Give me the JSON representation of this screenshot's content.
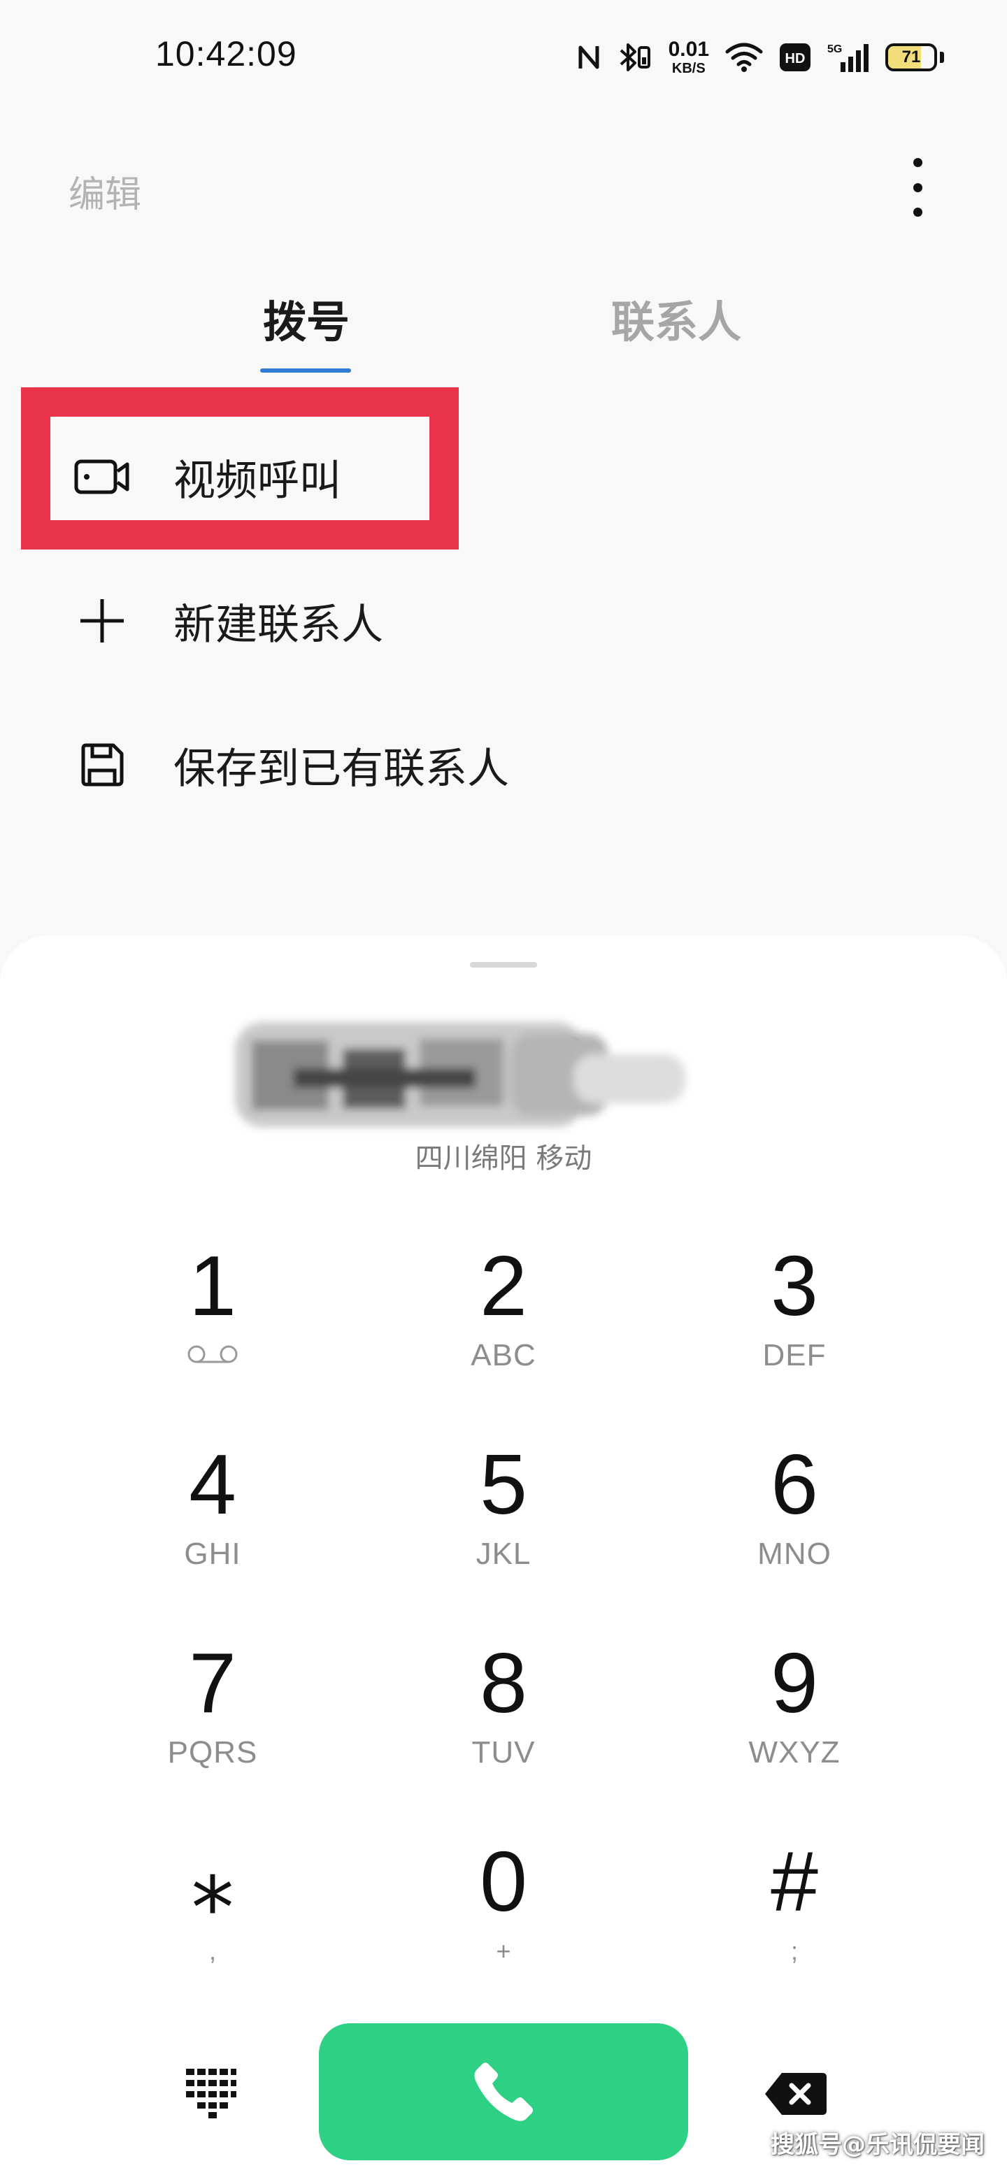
{
  "status_bar": {
    "time": "10:42:09",
    "net_speed_value": "0.01",
    "net_speed_unit": "KB/S",
    "hd_label": "HD",
    "network_label": "5G",
    "battery_percent": 71,
    "battery_label": "71",
    "icons": [
      "nfc-icon",
      "bluetooth-icon",
      "wifi-icon",
      "hd-voice-icon",
      "signal-icon",
      "battery-icon"
    ]
  },
  "header": {
    "edit_label": "编辑",
    "more_icon": "more-vertical-icon"
  },
  "tabs": [
    {
      "label": "拨号",
      "active": true
    },
    {
      "label": "联系人",
      "active": false
    }
  ],
  "options": [
    {
      "label": "视频呼叫",
      "icon": "video-call-icon",
      "highlighted": true
    },
    {
      "label": "新建联系人",
      "icon": "plus-icon"
    },
    {
      "label": "保存到已有联系人",
      "icon": "save-icon"
    }
  ],
  "dialer": {
    "number_visible": "1          33",
    "location": "四川绵阳 移动"
  },
  "keypad": [
    {
      "digit": "1",
      "letters": "",
      "icon": "voicemail-icon"
    },
    {
      "digit": "2",
      "letters": "ABC"
    },
    {
      "digit": "3",
      "letters": "DEF"
    },
    {
      "digit": "4",
      "letters": "GHI"
    },
    {
      "digit": "5",
      "letters": "JKL"
    },
    {
      "digit": "6",
      "letters": "MNO"
    },
    {
      "digit": "7",
      "letters": "PQRS"
    },
    {
      "digit": "8",
      "letters": "TUV"
    },
    {
      "digit": "9",
      "letters": "WXYZ"
    },
    {
      "digit": "⁎",
      "letters": ","
    },
    {
      "digit": "0",
      "letters": "+"
    },
    {
      "digit": "#",
      "letters": ";"
    }
  ],
  "controls": {
    "dialpad_icon": "dialpad-icon",
    "call_icon": "phone-icon",
    "backspace_icon": "backspace-icon"
  },
  "colors": {
    "accent_blue": "#2f7bd6",
    "call_green": "#2ed084",
    "highlight_red": "#e9334a"
  },
  "watermark": "搜狐号@乐讯侃要闻"
}
